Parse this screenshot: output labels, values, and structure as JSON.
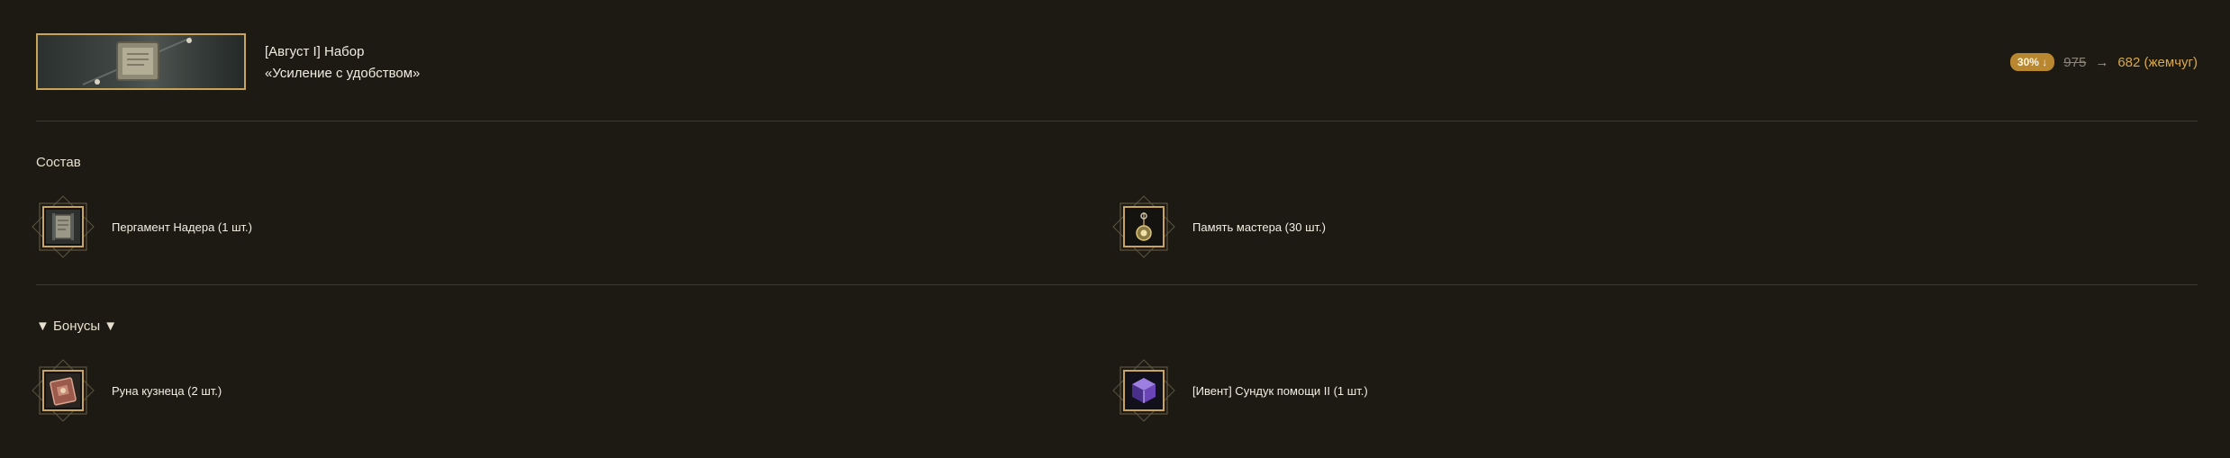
{
  "header": {
    "title_line1": "[Август I] Набор",
    "title_line2": "«Усиление с удобством»",
    "thumbnail_icon": "scroll-banner-icon"
  },
  "price": {
    "discount": "30%",
    "discount_icon": "down-arrow-icon",
    "old_price": "975",
    "arrow": "→",
    "new_price": "682 (жемчуг)"
  },
  "composition": {
    "title": "Состав",
    "items": [
      {
        "label": "Пергамент Надера (1 шт.)",
        "icon": "parchment-icon"
      },
      {
        "label": "Память мастера (30 шт.)",
        "icon": "pendant-icon"
      }
    ]
  },
  "bonuses": {
    "title": "▼ Бонусы ▼",
    "items": [
      {
        "label": "Руна кузнеца (2 шт.)",
        "icon": "rune-book-icon"
      },
      {
        "label": "[Ивент] Сундук помощи II (1 шт.)",
        "icon": "purple-chest-icon"
      }
    ]
  },
  "colors": {
    "background": "#1c1a13",
    "accent_gold": "#c9a55b",
    "price_gold": "#d9a94d",
    "divider": "#3d3a2f"
  }
}
